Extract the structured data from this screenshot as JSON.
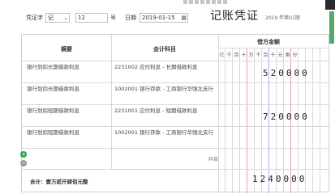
{
  "toolbar": {
    "voucher_word_label": "凭证字",
    "voucher_word_value": "记",
    "number_value": "12",
    "number_suffix": "号",
    "date_label": "日期",
    "date_value": "2019-01-15",
    "title": "记账凭证",
    "period": "2019 年第01期"
  },
  "table": {
    "headers": {
      "summary": "摘要",
      "account": "会计科目",
      "amount": "借方金额"
    },
    "digit_labels": [
      "亿",
      "千",
      "百",
      "十",
      "万",
      "千",
      "百",
      "十",
      "元",
      "角",
      "分"
    ],
    "rows": [
      {
        "summary": "银行划扣长期借款利息",
        "account": "2231002 应付利息 - 长期借款利息",
        "amount": "520000"
      },
      {
        "summary": "银行划扣长期借款利息",
        "account": "1002001 银行存款 - 工商银行华强北支行",
        "amount": ""
      },
      {
        "summary": "银行划扣短期借款利息",
        "account": "2231001 应付利息 - 短期借款利息",
        "amount": "720000"
      },
      {
        "summary": "银行划扣短期借款利息",
        "account": "1002001 银行存款 - 工商银行华强北支行",
        "amount": ""
      },
      {
        "summary": "",
        "account": "科目",
        "amount": ""
      }
    ],
    "total_label": "合计：壹万贰仟肆佰元整",
    "total_amount": "1240000"
  },
  "icons": {
    "add_row": "plus-circle-icon",
    "calendar": "calendar-icon"
  },
  "colors": {
    "accent": "#22a84a"
  }
}
